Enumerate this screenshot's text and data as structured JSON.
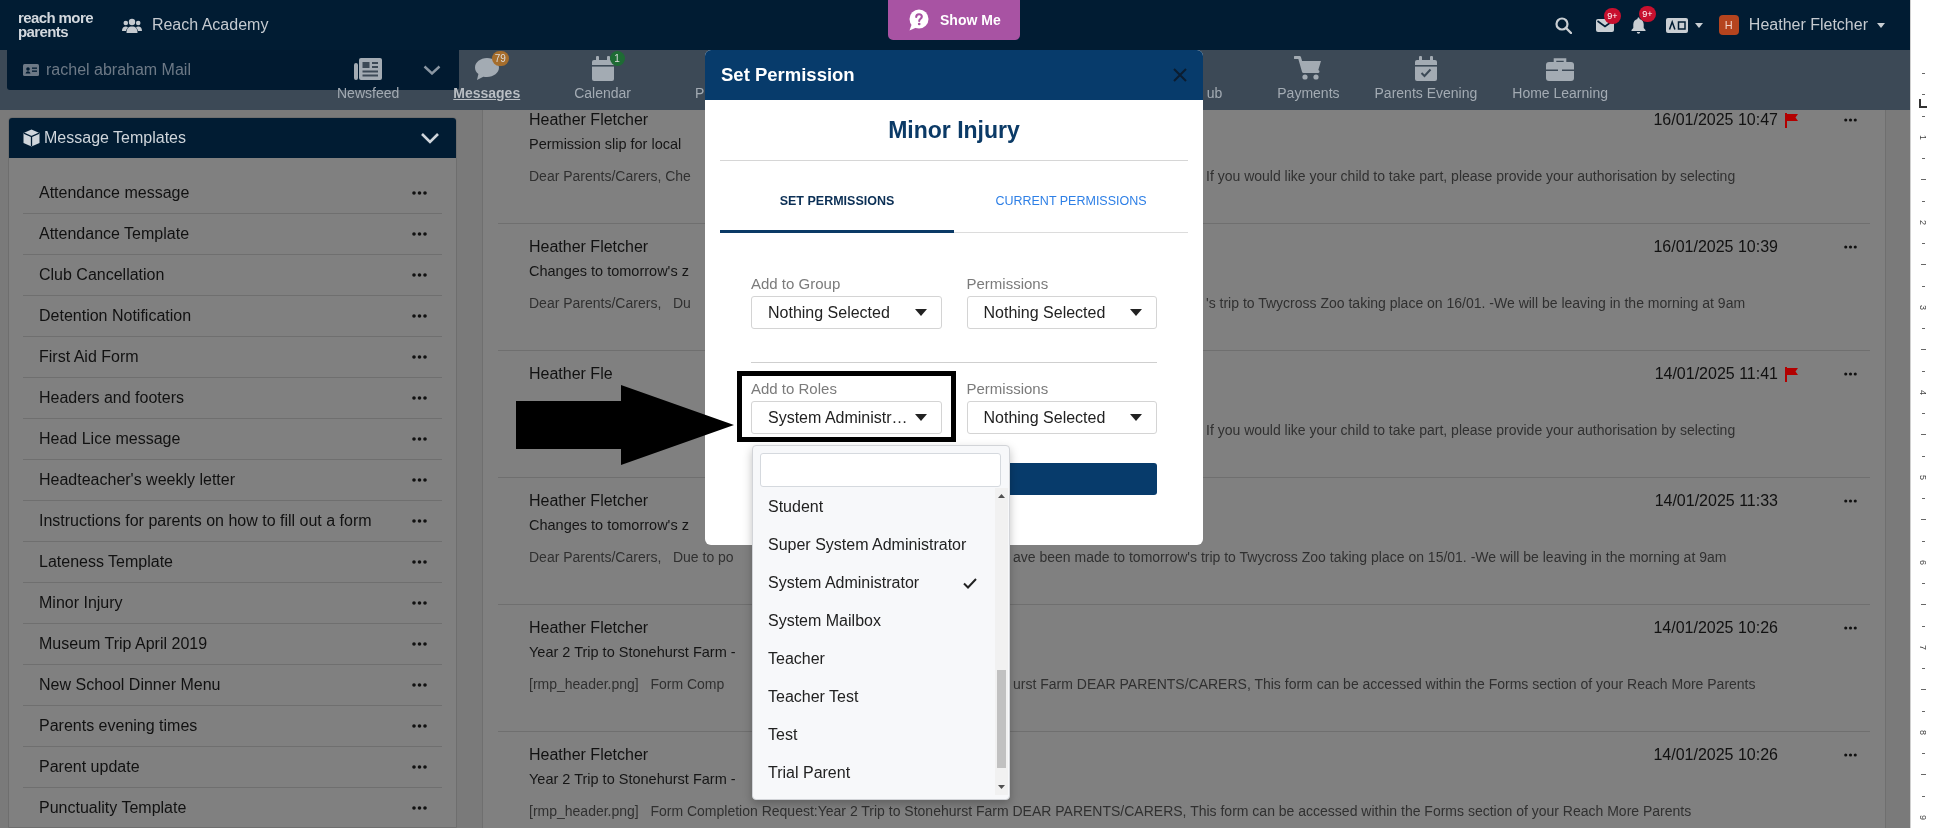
{
  "top_bar": {
    "logo": [
      "reach more",
      "parents"
    ],
    "school": "Reach Academy",
    "help_button": "Show Me",
    "mail_badge": "9+",
    "alerts_badge": "9+",
    "user_initial": "H",
    "user_name": "Heather Fletcher"
  },
  "mailbox": "rachel abraham Mail",
  "nav": [
    {
      "kind": "newsfeed",
      "label": "Newsfeed",
      "selected": false
    },
    {
      "kind": "messages",
      "label": "Messages",
      "selected": true,
      "badge": {
        "text": "79",
        "color": "#a56d2c"
      }
    },
    {
      "kind": "calendar",
      "label": "Calendar",
      "selected": false,
      "badge": {
        "text": "1",
        "color": "#1e6b34"
      }
    },
    {
      "kind": "fragment",
      "label": "P",
      "selected": false
    },
    {
      "kind": "fragment",
      "label": "ub",
      "selected": false
    },
    {
      "kind": "payments",
      "label": "Payments",
      "selected": false
    },
    {
      "kind": "evening",
      "label": "Parents Evening",
      "selected": false
    },
    {
      "kind": "learning",
      "label": "Home Learning",
      "selected": false
    }
  ],
  "sidebar": {
    "title": "Message Templates",
    "items": [
      "Attendance message",
      "Attendance Template",
      "Club Cancellation",
      "Detention Notification",
      "First Aid Form",
      "Headers and footers",
      "Head Lice message",
      "Headteacher's weekly letter",
      "Instructions for parents on how to fill out a form",
      "Lateness Template",
      "Minor Injury",
      "Museum Trip April 2019",
      "New School Dinner Menu",
      "Parents evening times",
      "Parent update",
      "Punctuality Template"
    ]
  },
  "messages": [
    {
      "sender": "Heather Fletcher",
      "subject": "Permission slip for local",
      "preview_start": "Dear Parents/Carers, Che",
      "preview_end": "If you would like your child to take part, please provide your authorisation by selecting",
      "date": "16/01/2025 10:47",
      "flagged": true
    },
    {
      "sender": "Heather Fletcher",
      "subject": "Changes to tomorrow's z",
      "preview_start": "Dear Parents/Carers,   Du",
      "preview_end": "'s trip to Twycross Zoo taking place on 16/01. -We will be leaving in the morning at 9am",
      "date": "16/01/2025 10:39",
      "flagged": false
    },
    {
      "sender": "Heather Fle",
      "preview_end": "If you would like your child to take part, please provide your authorisation by selecting",
      "date": "14/01/2025 11:41",
      "flagged": true
    },
    {
      "sender": "Heather Fletcher",
      "subject": "Changes to tomorrow's z",
      "preview_start": "Dear Parents/Carers,   Due to po",
      "preview_end": "ave been made to tomorrow's trip to Twycross Zoo taking place on 15/01. -We will be leaving in the morning at 9am",
      "date": "14/01/2025 11:33",
      "flagged": false
    },
    {
      "sender": "Heather Fletcher",
      "subject": "Year 2 Trip to Stonehurst Farm -",
      "preview_start": "[rmp_header.png]   Form Comp",
      "preview_end": "urst Farm DEAR PARENTS/CARERS, This form can be accessed within the Forms section of your Reach More Parents",
      "date": "14/01/2025 10:26",
      "flagged": false
    },
    {
      "sender": "Heather Fletcher",
      "subject": "Year 2 Trip to Stonehurst Farm -",
      "preview": "[rmp_header.png]   Form Completion Request:Year 2 Trip to Stonehurst Farm DEAR PARENTS/CARERS, This form can be accessed within the Forms section of your Reach More Parents",
      "date": "14/01/2025 10:26",
      "flagged": false
    }
  ],
  "dialog": {
    "title": "Set Permission",
    "heading": "Minor Injury",
    "tabs": [
      {
        "label": "SET PERMISSIONS",
        "selected": true
      },
      {
        "label": "CURRENT PERMISSIONS",
        "selected": false
      }
    ],
    "fields": [
      {
        "label": "Add to Group",
        "value": "Nothing Selected",
        "permissions_label": "Permissions",
        "permissions_value": "Nothing Selected",
        "outlined": false
      },
      {
        "label": "Add to Roles",
        "value": "System Administr…",
        "permissions_label": "Permissions",
        "permissions_value": "Nothing Selected",
        "outlined": true
      }
    ],
    "role_options": [
      {
        "label": "Student",
        "selected": false
      },
      {
        "label": "Super System Administrator",
        "selected": false
      },
      {
        "label": "System Administrator",
        "selected": true
      },
      {
        "label": "System Mailbox",
        "selected": false
      },
      {
        "label": "Teacher",
        "selected": false
      },
      {
        "label": "Teacher Test",
        "selected": false
      },
      {
        "label": "Test",
        "selected": false
      },
      {
        "label": "Trial Parent",
        "selected": false
      }
    ]
  },
  "callout_arrow": true,
  "ruler": [
    "1",
    "2",
    "3",
    "4",
    "5",
    "6",
    "7",
    "8",
    "9"
  ]
}
